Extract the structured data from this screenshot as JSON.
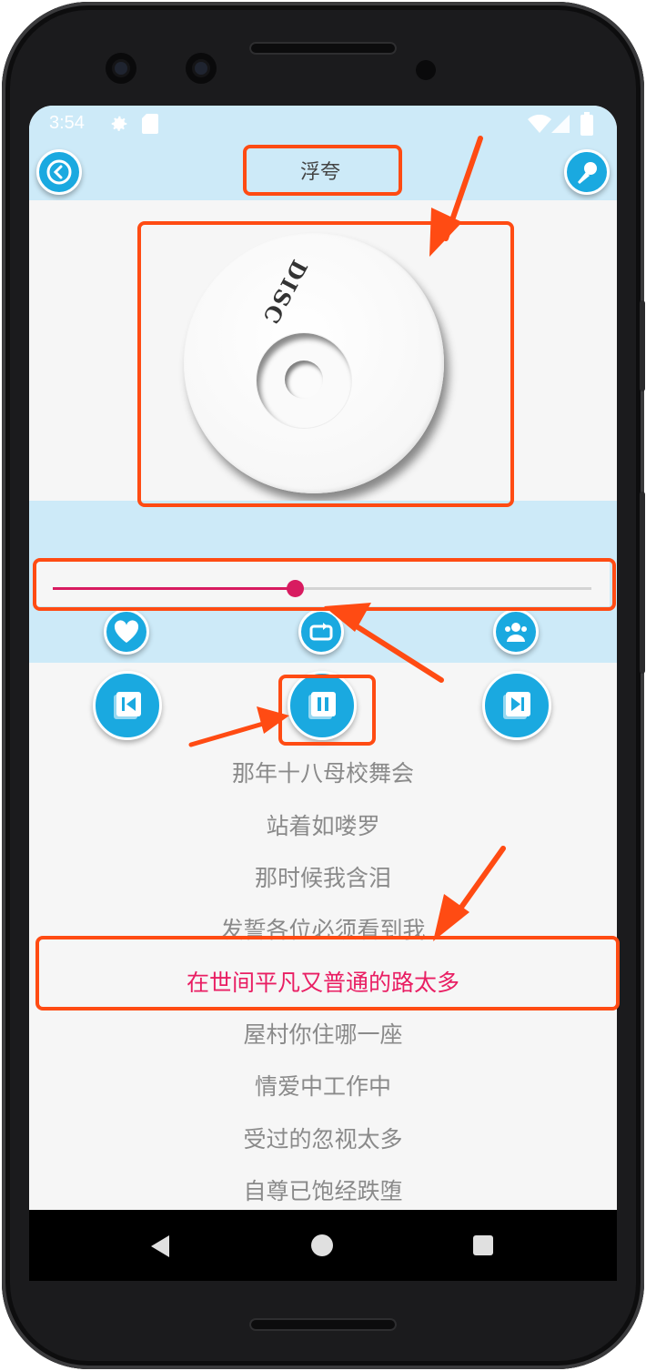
{
  "status_bar": {
    "time": "3:54"
  },
  "header": {
    "title": "浮夸"
  },
  "disc": {
    "label": "DISC"
  },
  "player": {
    "progress": 0.45,
    "progress_color": "#d81b60",
    "accent_color": "#1aa9e0"
  },
  "icons": {
    "back": "back-circle-icon",
    "mic": "microphone-icon",
    "favorite": "heart-icon",
    "repeat": "repeat-icon",
    "share": "share-icon",
    "previous": "skip-previous-icon",
    "pause": "pause-icon",
    "next": "skip-next-icon"
  },
  "lyrics": [
    {
      "text": "那年十八母校舞会",
      "active": false
    },
    {
      "text": "站着如喽罗",
      "active": false
    },
    {
      "text": "那时候我含泪",
      "active": false
    },
    {
      "text": "发誓各位必须看到我",
      "active": false
    },
    {
      "text": "在世间平凡又普通的路太多",
      "active": true
    },
    {
      "text": "屋村你住哪一座",
      "active": false
    },
    {
      "text": "情爱中工作中",
      "active": false
    },
    {
      "text": "受过的忽视太多",
      "active": false
    },
    {
      "text": "自尊已饱经跌堕",
      "active": false
    }
  ],
  "annotations": {
    "color": "#ff4b13"
  }
}
